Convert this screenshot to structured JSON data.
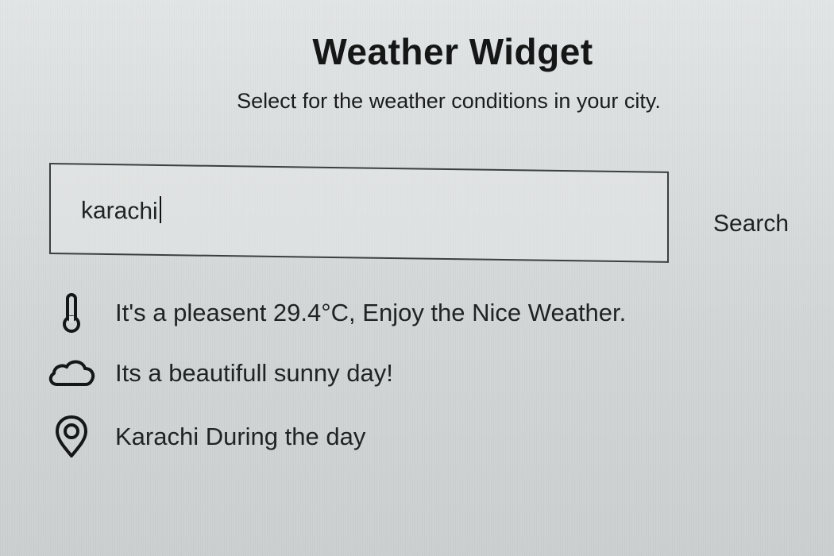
{
  "header": {
    "title": "Weather Widget",
    "subtitle": "Select for the weather conditions in your city."
  },
  "search": {
    "value": "karachi",
    "button_label": "Search"
  },
  "results": {
    "temperature_text": "It's a pleasent 29.4°C, Enjoy the Nice Weather.",
    "condition_text": "Its a beautifull sunny day!",
    "location_text": "Karachi During the day"
  },
  "icons": {
    "temperature": "thermometer-icon",
    "condition": "cloud-icon",
    "location": "location-pin-icon"
  }
}
